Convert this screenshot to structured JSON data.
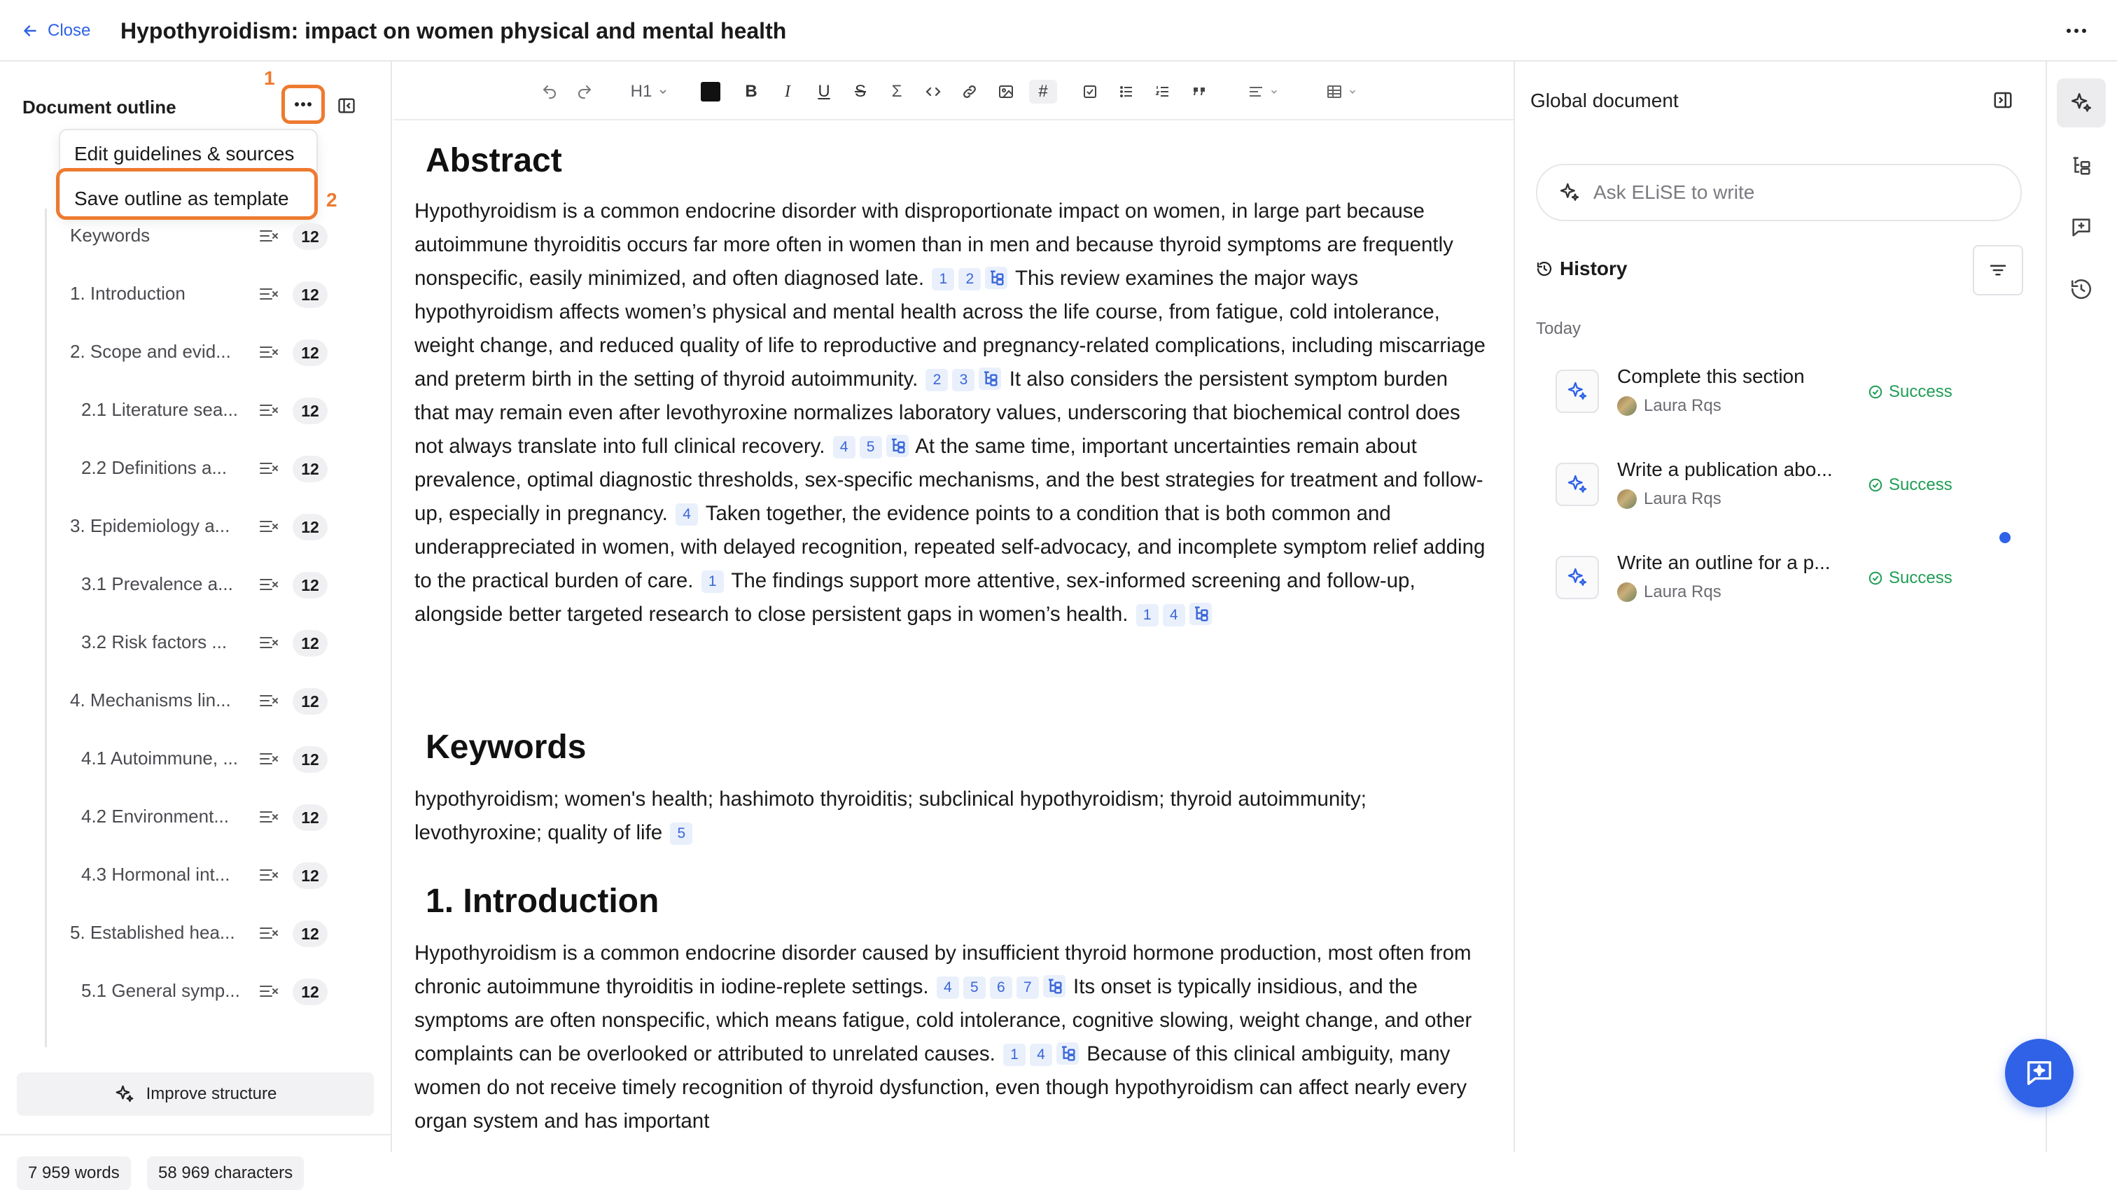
{
  "header": {
    "close_label": "Close",
    "title": "Hypothyroidism: impact on women physical and mental health"
  },
  "outline": {
    "title": "Document outline",
    "step_markers": [
      "1",
      "2"
    ],
    "menu": [
      "Edit guidelines & sources",
      "Save outline as template"
    ],
    "items": [
      {
        "label": "Keywords",
        "badge": "12",
        "level": 1
      },
      {
        "label": "1. Introduction",
        "badge": "12",
        "level": 1
      },
      {
        "label": "2. Scope and evid...",
        "badge": "12",
        "level": 1
      },
      {
        "label": "2.1 Literature sea...",
        "badge": "12",
        "level": 2
      },
      {
        "label": "2.2 Definitions a...",
        "badge": "12",
        "level": 2
      },
      {
        "label": "3. Epidemiology a...",
        "badge": "12",
        "level": 1
      },
      {
        "label": "3.1 Prevalence a...",
        "badge": "12",
        "level": 2
      },
      {
        "label": "3.2 Risk factors ...",
        "badge": "12",
        "level": 2
      },
      {
        "label": "4. Mechanisms lin...",
        "badge": "12",
        "level": 1
      },
      {
        "label": "4.1 Autoimmune, ...",
        "badge": "12",
        "level": 2
      },
      {
        "label": "4.2 Environment...",
        "badge": "12",
        "level": 2
      },
      {
        "label": "4.3 Hormonal int...",
        "badge": "12",
        "level": 2
      },
      {
        "label": "5. Established hea...",
        "badge": "12",
        "level": 1
      },
      {
        "label": "5.1 General symp...",
        "badge": "12",
        "level": 2
      }
    ],
    "improve_label": "Improve structure",
    "words": "7 959 words",
    "characters": "58 969 characters"
  },
  "toolbar": {
    "heading_value": "H1",
    "text_color": "#111111"
  },
  "document": {
    "sections": [
      {
        "heading": "Abstract",
        "paragraphs": [
          [
            {
              "t": "Hypothyroidism is a common endocrine disorder with disproportionate impact on women, in large part because autoimmune thyroiditis occurs far more often in women than in men and because thyroid symptoms are frequently nonspecific, easily minimized, and often diagnosed late."
            },
            {
              "refs": [
                "1",
                "2"
              ]
            },
            {
              "t": "This review examines the major ways hypothyroidism affects women’s physical and mental health across the life course, from fatigue, cold intolerance, weight change, and reduced quality of life to reproductive and pregnancy-related complications, including miscarriage and preterm birth in the setting of thyroid autoimmunity."
            },
            {
              "refs": [
                "2",
                "3"
              ]
            },
            {
              "t": "It also considers the persistent symptom burden that may remain even after levothyroxine normalizes laboratory values, underscoring that biochemical control does not always translate into full clinical recovery."
            },
            {
              "refs": [
                "4",
                "5"
              ]
            },
            {
              "t": "At the same time, important uncertainties remain about prevalence, optimal diagnostic thresholds, sex-specific mechanisms, and the best strategies for treatment and follow-up, especially in pregnancy."
            },
            {
              "refs": [
                "4"
              ],
              "nosrc": true
            },
            {
              "t": "Taken together, the evidence points to a condition that is both common and underappreciated in women, with delayed recognition, repeated self-advocacy, and incomplete symptom relief adding to the practical burden of care."
            },
            {
              "refs": [
                "1"
              ],
              "nosrc": true
            },
            {
              "t": "The findings support more attentive, sex-informed screening and follow-up, alongside better targeted research to close persistent gaps in women’s health."
            },
            {
              "refs": [
                "1",
                "4"
              ]
            }
          ]
        ]
      },
      {
        "heading": "Keywords",
        "paragraphs": [
          [
            {
              "t": "hypothyroidism; women's health; hashimoto thyroiditis; subclinical hypothyroidism; thyroid autoimmunity; levothyroxine; quality of life"
            },
            {
              "refs": [
                "5"
              ],
              "nosrc": true
            }
          ]
        ]
      },
      {
        "heading": "1. Introduction",
        "paragraphs": [
          [
            {
              "t": "Hypothyroidism is a common endocrine disorder caused by insufficient thyroid hormone production, most often from chronic autoimmune thyroiditis in iodine-replete settings."
            },
            {
              "refs": [
                "4",
                "5",
                "6",
                "7"
              ]
            },
            {
              "t": "Its onset is typically insidious, and the symptoms are often nonspecific, which means fatigue, cold intolerance, cognitive slowing, weight change, and other complaints can be overlooked or attributed to unrelated causes."
            },
            {
              "refs": [
                "1",
                "4"
              ]
            },
            {
              "t": "Because of this clinical ambiguity, many women do not receive timely recognition of thyroid dysfunction, even though hypothyroidism can affect nearly every organ system and has important"
            }
          ]
        ]
      }
    ]
  },
  "right_panel": {
    "title": "Global document",
    "ask_placeholder": "Ask ELiSE to write",
    "history_title": "History",
    "today_label": "Today",
    "history": [
      {
        "title": "Complete this section",
        "user": "Laura Rqs",
        "status": "Success",
        "unread": false
      },
      {
        "title": "Write a publication abo...",
        "user": "Laura Rqs",
        "status": "Success",
        "unread": false
      },
      {
        "title": "Write an outline for a p...",
        "user": "Laura Rqs",
        "status": "Success",
        "unread": true
      }
    ]
  },
  "icons": {
    "rail": [
      "ai-sparkle-icon",
      "outline-tree-icon",
      "comment-add-icon",
      "history-icon"
    ],
    "fab": "chat-fab-icon"
  },
  "colors": {
    "accent": "#2f62e6",
    "highlight": "#ee7a2f",
    "success": "#1f9d55"
  }
}
